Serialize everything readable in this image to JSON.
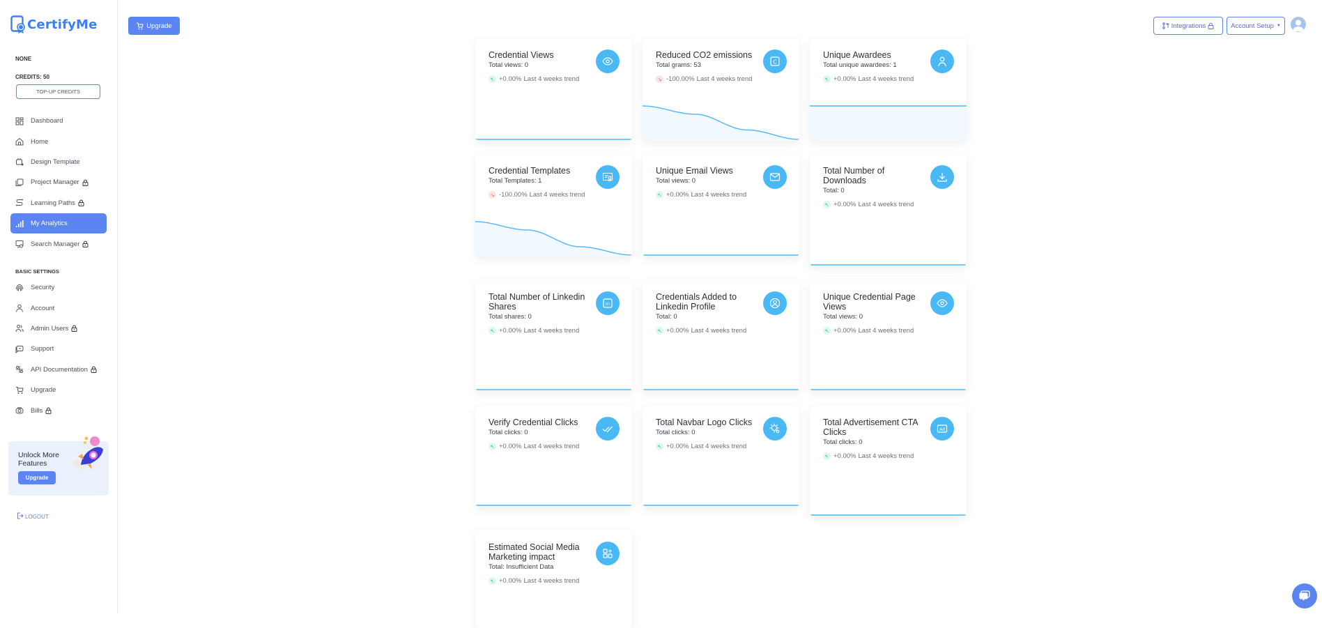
{
  "app": {
    "name": "CertifyMe"
  },
  "sidebar": {
    "plan": "NONE",
    "credits": "CREDITS: 50",
    "topup_label": "TOP-UP CREDITS",
    "items": [
      {
        "label": "Dashboard",
        "icon": "dashboard-icon",
        "locked": false,
        "active": false
      },
      {
        "label": "Home",
        "icon": "home-icon",
        "locked": false,
        "active": false
      },
      {
        "label": "Design Template",
        "icon": "design-template-icon",
        "locked": false,
        "active": false
      },
      {
        "label": "Project Manager",
        "icon": "project-manager-icon",
        "locked": true,
        "active": false
      },
      {
        "label": "Learning Paths",
        "icon": "learning-paths-icon",
        "locked": true,
        "active": false
      },
      {
        "label": "My Analytics",
        "icon": "analytics-icon",
        "locked": false,
        "active": true
      },
      {
        "label": "Search Manager",
        "icon": "search-manager-icon",
        "locked": true,
        "active": false
      }
    ],
    "section_label": "BASIC SETTINGS",
    "settings_items": [
      {
        "label": "Security",
        "icon": "fingerprint-icon",
        "locked": false
      },
      {
        "label": "Account",
        "icon": "user-icon",
        "locked": false
      },
      {
        "label": "Admin Users",
        "icon": "users-icon",
        "locked": true
      },
      {
        "label": "Support",
        "icon": "support-icon",
        "locked": false
      },
      {
        "label": "API Documentation",
        "icon": "api-icon",
        "locked": true
      },
      {
        "label": "Upgrade",
        "icon": "cart-icon",
        "locked": false
      },
      {
        "label": "Bills",
        "icon": "bills-icon",
        "locked": true
      }
    ],
    "promo": {
      "title": "Unlock More Features",
      "button": "Upgrade"
    },
    "logout": "LOGOUT"
  },
  "topbar": {
    "upgrade": "Upgrade",
    "integrations": "Integrations",
    "account_setup": "Account Setup"
  },
  "colors": {
    "accent": "#5b86f2",
    "icon_circle": "#4bb8f6",
    "trend_up": "#27c38a",
    "trend_down": "#ee5a5a"
  },
  "cards": [
    {
      "title": "Credential Views",
      "sub": "Total views: 0",
      "trend": "+0.00%",
      "trend_label": "Last 4 weeks trend",
      "direction": "up",
      "icon": "eye-icon",
      "series": [
        0,
        0,
        0,
        0
      ]
    },
    {
      "title": "Reduced CO2 emissions",
      "sub": "Total grams: 53",
      "trend": "-100.00%",
      "trend_label": "Last 4 weeks trend",
      "direction": "down",
      "icon": "carbon-icon",
      "series": [
        53,
        40,
        15,
        0
      ]
    },
    {
      "title": "Unique Awardees",
      "sub": "Total unique awardees: 1",
      "trend": "+0.00%",
      "trend_label": "Last 4 weeks trend",
      "direction": "up",
      "icon": "person-icon",
      "series": [
        1,
        1,
        1,
        1
      ]
    },
    {
      "title": "Credential Templates",
      "sub": "Total Templates: 1",
      "trend": "-100.00%",
      "trend_label": "Last 4 weeks trend",
      "direction": "down",
      "icon": "certificate-icon",
      "series": [
        1,
        0.75,
        0.25,
        0
      ]
    },
    {
      "title": "Unique Email Views",
      "sub": "Total views: 0",
      "trend": "+0.00%",
      "trend_label": "Last 4 weeks trend",
      "direction": "up",
      "icon": "mail-icon",
      "series": [
        0,
        0,
        0,
        0
      ]
    },
    {
      "title": "Total Number of Downloads",
      "sub": "Total: 0",
      "trend": "+0.00%",
      "trend_label": "Last 4 weeks trend",
      "direction": "up",
      "icon": "download-icon",
      "series": [
        0,
        0,
        0,
        0
      ]
    },
    {
      "title": "Total Number of Linkedin Shares",
      "sub": "Total shares: 0",
      "trend": "+0.00%",
      "trend_label": "Last 4 weeks trend",
      "direction": "up",
      "icon": "linkedin-icon",
      "series": [
        0,
        0,
        0,
        0
      ]
    },
    {
      "title": "Credentials Added to Linkedin Profile",
      "sub": "Total: 0",
      "trend": "+0.00%",
      "trend_label": "Last 4 weeks trend",
      "direction": "up",
      "icon": "profile-icon",
      "series": [
        0,
        0,
        0,
        0
      ]
    },
    {
      "title": "Unique Credential Page Views",
      "sub": "Total views: 0",
      "trend": "+0.00%",
      "trend_label": "Last 4 weeks trend",
      "direction": "up",
      "icon": "eye-icon",
      "series": [
        0,
        0,
        0,
        0
      ]
    },
    {
      "title": "Verify Credential Clicks",
      "sub": "Total clicks: 0",
      "trend": "+0.00%",
      "trend_label": "Last 4 weeks trend",
      "direction": "up",
      "icon": "double-check-icon",
      "series": [
        0,
        0,
        0,
        0
      ]
    },
    {
      "title": "Total Navbar Logo Clicks",
      "sub": "Total clicks: 0",
      "trend": "+0.00%",
      "trend_label": "Last 4 weeks trend",
      "direction": "up",
      "icon": "logo-search-icon",
      "series": [
        0,
        0,
        0,
        0
      ]
    },
    {
      "title": "Total Advertisement CTA Clicks",
      "sub": "Total clicks: 0",
      "trend": "+0.00%",
      "trend_label": "Last 4 weeks trend",
      "direction": "up",
      "icon": "ad-icon",
      "series": [
        0,
        0,
        0,
        0
      ]
    },
    {
      "title": "Estimated Social Media Marketing impact",
      "sub": "Total: Insufficient Data",
      "trend": "+0.00%",
      "trend_label": "Last 4 weeks trend",
      "direction": "up",
      "icon": "apps-add-icon",
      "series": []
    }
  ]
}
